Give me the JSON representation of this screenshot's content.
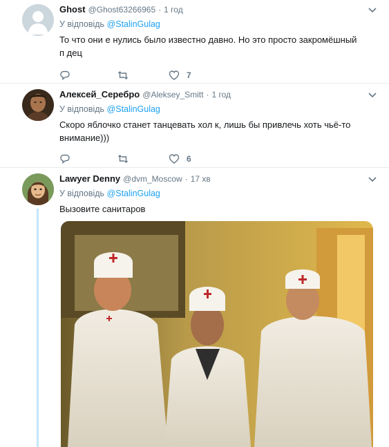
{
  "tweets": [
    {
      "name": "Ghost",
      "handle": "@Ghost63266965",
      "dot": "·",
      "time": "1 год",
      "reply_prefix": "У відповідь",
      "reply_handle": "@StalinGulag",
      "text": "То что они е  нулись было известно давно. Но это просто закромёшный п  дец",
      "likes": "7"
    },
    {
      "name": "Алексей_Серебро",
      "handle": "@Aleksey_Smitt",
      "dot": "·",
      "time": "1 год",
      "reply_prefix": "У відповідь",
      "reply_handle": "@StalinGulag",
      "text": "Скоро яблочко станет танцевать хол  к, лишь бы привлечь хоть чьё-то внимание)))",
      "likes": "6"
    },
    {
      "name": "Lawyer Denny",
      "handle": "@dvm_Moscow",
      "dot": "·",
      "time": "17 хв",
      "reply_prefix": "У відповідь",
      "reply_handle": "@StalinGulag",
      "text": "Вызовите санитаров"
    }
  ],
  "icons": {
    "reply": "reply-icon",
    "retweet": "retweet-icon",
    "like": "heart-icon",
    "caret": "chevron-down-icon"
  },
  "colors": {
    "accent": "#1da1f2",
    "secondary_text": "#657786",
    "thread_line": "#c4e6fb"
  }
}
